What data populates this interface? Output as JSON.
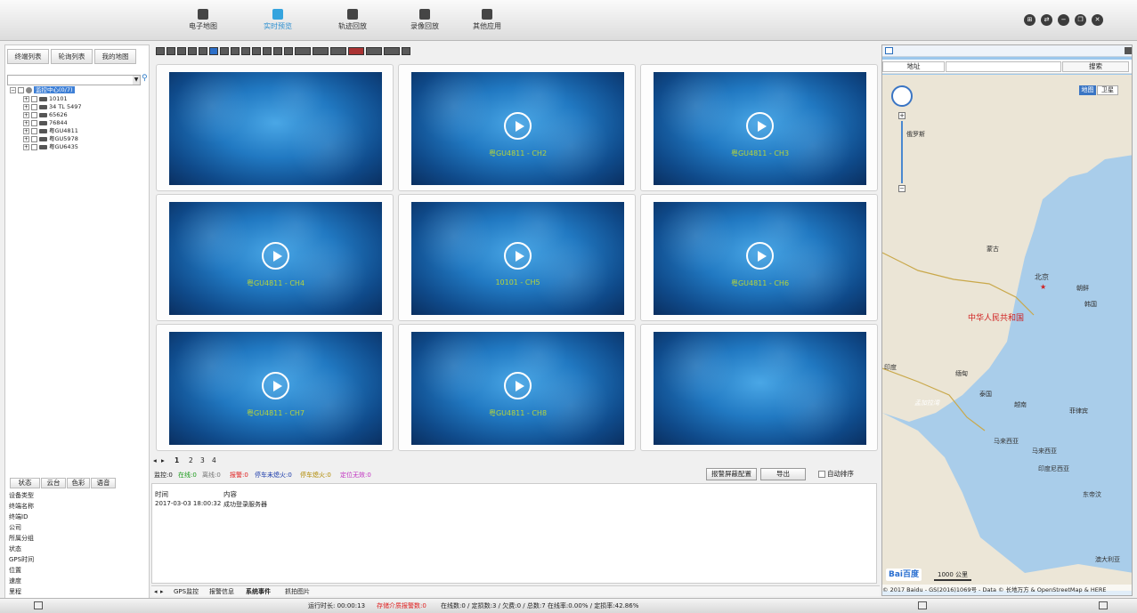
{
  "top_nav": [
    {
      "label": "电子地图",
      "icon": "map-icon"
    },
    {
      "label": "实时预览",
      "icon": "video-icon"
    },
    {
      "label": "轨迹回放",
      "icon": "vehicle-icon"
    },
    {
      "label": "录像回放",
      "icon": "recording-icon"
    },
    {
      "label": "其他应用",
      "icon": "apps-icon"
    }
  ],
  "left_tabs": [
    "终端列表",
    "轮询列表",
    "我的地图"
  ],
  "tree": {
    "root": "监控中心(0/7)",
    "nodes": [
      "10101",
      "34 TL 5497",
      "65626",
      "76844",
      "粤GU4811",
      "粤GU5978",
      "粤GU6435"
    ]
  },
  "status_tabs": [
    "状态",
    "云台",
    "色彩",
    "语音"
  ],
  "props": [
    "设备类型",
    "终端名称",
    "终端ID",
    "公司",
    "所属分组",
    "状态",
    "GPS时间",
    "位置",
    "速度",
    "里程"
  ],
  "videos": [
    "",
    "粤GU4811 - CH2",
    "粤GU4811 - CH3",
    "粤GU4811 - CH4",
    "10101 - CH5",
    "粤GU4811 - CH6",
    "粤GU4811 - CH7",
    "粤GU4811 - CH8",
    ""
  ],
  "pages": [
    "1",
    "2",
    "3",
    "4"
  ],
  "stats": {
    "monitor": "监控:0",
    "online": "在线:0",
    "offline": "离线:0",
    "alarm": "报警:0",
    "stopped_on": "停车未熄火:0",
    "stopped_off": "停车熄火:0",
    "invalid": "定位无效:0"
  },
  "buttons": {
    "alarm_config": "报警屏蔽配置",
    "export": "导出",
    "auto_sort": "自动排序"
  },
  "events": {
    "col_time": "时间",
    "col_content": "内容",
    "rows": [
      {
        "time": "2017-03-03 18:00:32",
        "content": "成功登录服务器"
      }
    ]
  },
  "bottom_tabs": [
    "GPS监控",
    "报警信息",
    "系统事件",
    "抓拍图片"
  ],
  "statusbar": {
    "runtime": "运行时长: 00:00:13",
    "storage_alarm": "存储介质报警数:0",
    "counts": "在线数:0 / 定损数:3 / 欠费:0 / 总数:7   在线率:0.00% / 定损率:42.86%"
  },
  "map": {
    "address_label": "地址",
    "search_label": "搜索",
    "map_type": "地图",
    "satellite": "卫星",
    "labels": {
      "russia": "俄罗斯",
      "mongolia": "蒙古",
      "beijing": "北京",
      "china": "中华人民共和国",
      "korea_n": "朝鲜",
      "korea_s": "韩国",
      "india": "印度",
      "myanmar": "缅甸",
      "thailand": "泰国",
      "vietnam": "越南",
      "philippines": "菲律宾",
      "bay_bengal": "孟加拉湾",
      "malaysia": "马来西亚",
      "malaysia2": "马来西亚",
      "indonesia": "印度尼西亚",
      "east_timor": "东帝汶",
      "australia": "澳大利亚"
    },
    "scale": "1000 公里",
    "copyright": "© 2017 Baidu - GS(2016)1069号 - Data © 长地万方 & OpenStreetMap & HERE"
  },
  "colors": {
    "accent": "#2a8ed0",
    "alarm": "#e02020",
    "online": "#1a9a1a"
  }
}
